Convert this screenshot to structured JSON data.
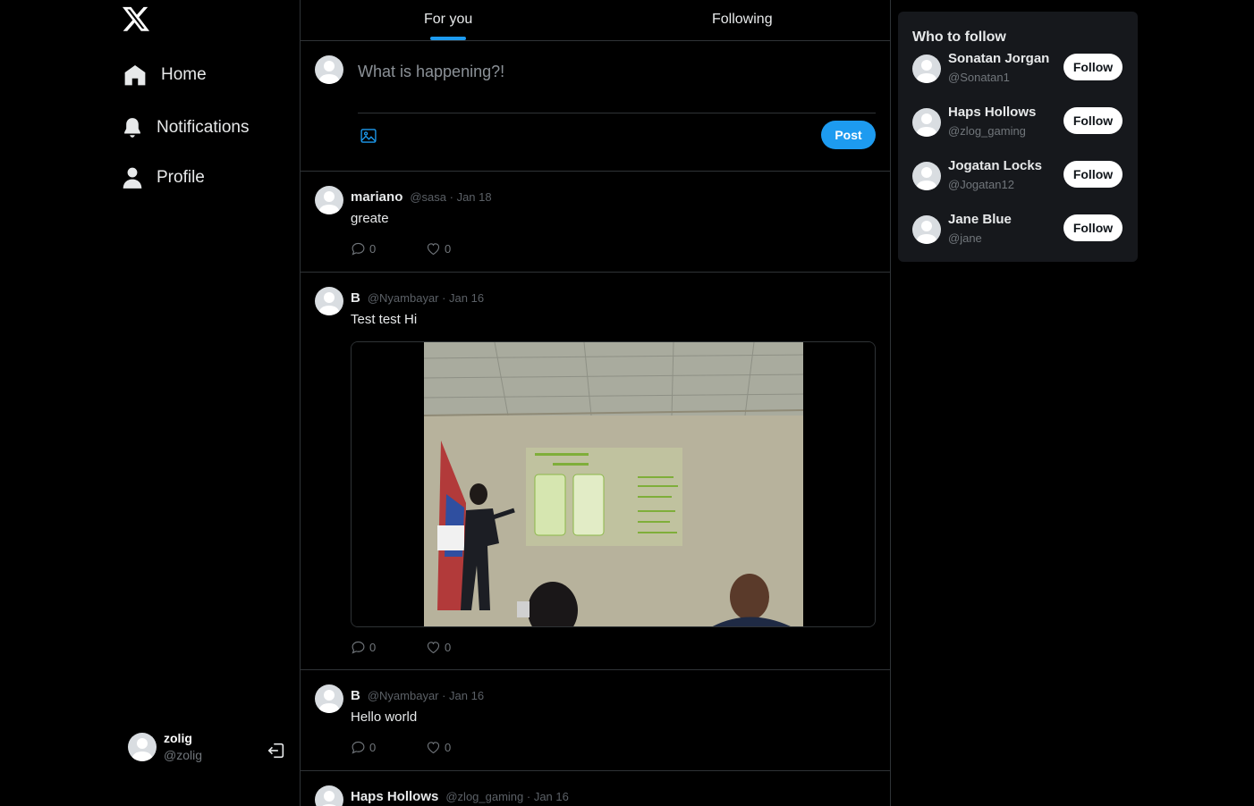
{
  "sidebar": {
    "logo_icon": "x-logo-icon",
    "items": [
      {
        "label": "Home",
        "icon": "home-icon"
      },
      {
        "label": "Notifications",
        "icon": "bell-icon"
      },
      {
        "label": "Profile",
        "icon": "user-icon"
      }
    ],
    "account": {
      "name": "zolig",
      "handle": "@zolig",
      "logout_icon": "logout-icon"
    }
  },
  "tabs": [
    {
      "label": "For you",
      "active": true
    },
    {
      "label": "Following",
      "active": false
    }
  ],
  "composer": {
    "placeholder": "What is happening?!",
    "post_label": "Post",
    "media_icon": "image-icon"
  },
  "posts": [
    {
      "name": "mariano",
      "meta": "@sasa · Jan 18",
      "text": "greate",
      "replies": "0",
      "likes": "0",
      "has_image": false
    },
    {
      "name": "B",
      "meta": "@Nyambayar · Jan 16",
      "text": "Test test Hi",
      "replies": "0",
      "likes": "0",
      "has_image": true
    },
    {
      "name": "B",
      "meta": "@Nyambayar · Jan 16",
      "text": "Hello world",
      "replies": "0",
      "likes": "0",
      "has_image": false
    },
    {
      "name": "Haps Hollows",
      "meta": "@zlog_gaming · Jan 16",
      "text": "",
      "replies": "",
      "likes": "",
      "has_image": false
    }
  ],
  "who_to_follow": {
    "title": "Who to follow",
    "follow_label": "Follow",
    "users": [
      {
        "name": "Sonatan Jorgan",
        "handle": "@Sonatan1"
      },
      {
        "name": "Haps Hollows",
        "handle": "@zlog_gaming"
      },
      {
        "name": "Jogatan Locks",
        "handle": "@Jogatan12"
      },
      {
        "name": "Jane Blue",
        "handle": "@jane"
      }
    ]
  },
  "colors": {
    "accent": "#1d9bf0",
    "background": "#000000",
    "panel": "#16181c",
    "border": "#2f3336"
  }
}
